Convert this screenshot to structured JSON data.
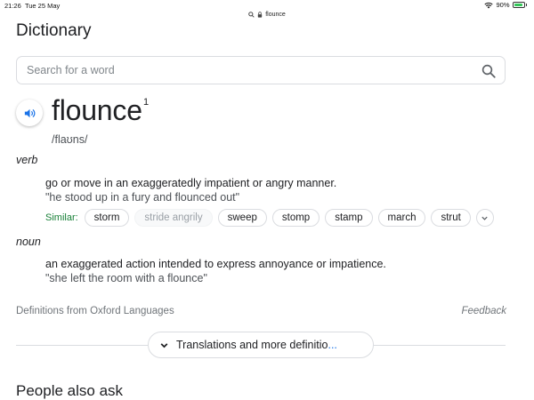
{
  "status_bar": {
    "time": "21:26",
    "date": "Tue 25 May",
    "battery_percent": "90%",
    "battery_level": 0.9
  },
  "url_bar": {
    "domain": "flounce"
  },
  "page": {
    "title": "Dictionary"
  },
  "search": {
    "placeholder": "Search for a word"
  },
  "entry": {
    "word": "flounce",
    "superscript": "1",
    "pronunciation": "/flaʊns/",
    "senses": [
      {
        "pos": "verb",
        "definition": "go or move in an exaggeratedly impatient or angry manner.",
        "example": "\"he stood up in a fury and flounced out\"",
        "similar_label": "Similar:",
        "similar": [
          "storm",
          "stride angrily",
          "sweep",
          "stomp",
          "stamp",
          "march",
          "strut"
        ]
      },
      {
        "pos": "noun",
        "definition": "an exaggerated action intended to express annoyance or impatience.",
        "example": "\"she left the room with a flounce\""
      }
    ]
  },
  "footer": {
    "source": "Definitions from Oxford Languages",
    "feedback": "Feedback"
  },
  "more_button": {
    "label": "Translations and more definitio",
    "ellipsis": "..."
  },
  "people_also_ask": {
    "heading": "People also ask"
  },
  "colors": {
    "accent_blue": "#1a73e8",
    "similar_green": "#188038",
    "battery_green": "#34c759"
  }
}
